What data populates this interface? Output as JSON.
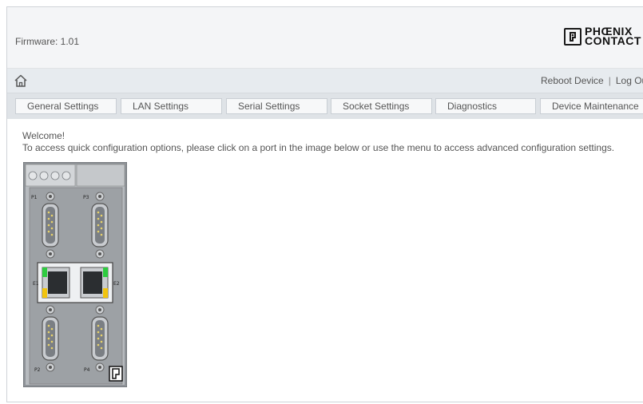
{
  "header": {
    "firmware_label": "Firmware: 1.01",
    "logo": {
      "line1": "PHŒNIX",
      "line2": "CONTACT"
    }
  },
  "navbar": {
    "home_icon": "home-icon",
    "reboot_label": "Reboot Device",
    "separator": "|",
    "logout_label": "Log Out"
  },
  "tabs": [
    {
      "label": "General Settings"
    },
    {
      "label": "LAN Settings"
    },
    {
      "label": "Serial Settings"
    },
    {
      "label": "Socket Settings"
    },
    {
      "label": "Diagnostics"
    },
    {
      "label": "Device Maintenance"
    }
  ],
  "main": {
    "welcome_title": "Welcome!",
    "welcome_text": "To access quick configuration options, please click on a port in the image below or use the menu to access advanced configuration settings."
  },
  "device": {
    "ports": [
      {
        "label": "P1"
      },
      {
        "label": "P3"
      },
      {
        "label": "P2"
      },
      {
        "label": "P4"
      }
    ],
    "ethernet": [
      {
        "label": "E1"
      },
      {
        "label": "E2"
      }
    ]
  },
  "colors": {
    "header_bg": "#f4f5f7",
    "navbar_bg": "#e7ebef",
    "tab_bar_bg": "#dfe3e7",
    "device_body": "#9a9ea3",
    "led_green": "#2ecc40",
    "led_yellow": "#f1c40f"
  }
}
